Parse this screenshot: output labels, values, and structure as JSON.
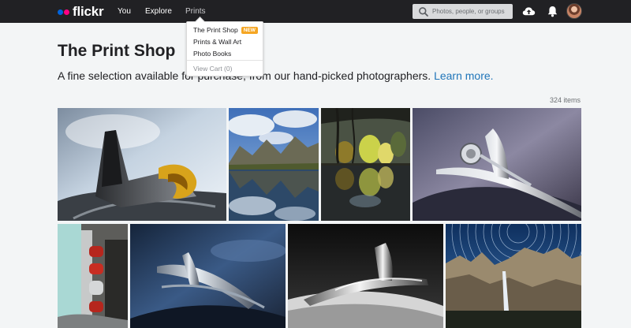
{
  "nav": {
    "logo_text": "flickr",
    "links": [
      "You",
      "Explore",
      "Prints"
    ],
    "search_placeholder": "Photos, people, or groups"
  },
  "dropdown": {
    "items": [
      {
        "label": "The Print Shop",
        "badge": "NEW"
      },
      {
        "label": "Prints & Wall Art"
      },
      {
        "label": "Photo Books"
      }
    ],
    "cart": "View Cart (0)"
  },
  "page": {
    "title": "The Print Shop",
    "subtitle": "A fine selection available for purchase, from our hand-picked photographers.",
    "learn_more": "Learn more.",
    "count": "324 items"
  },
  "colors": {
    "nav_bg": "#212124",
    "accent_link": "#1f75b9",
    "badge_new": "#f5a623",
    "logo_blue": "#0063dc",
    "logo_pink": "#ff0084"
  }
}
